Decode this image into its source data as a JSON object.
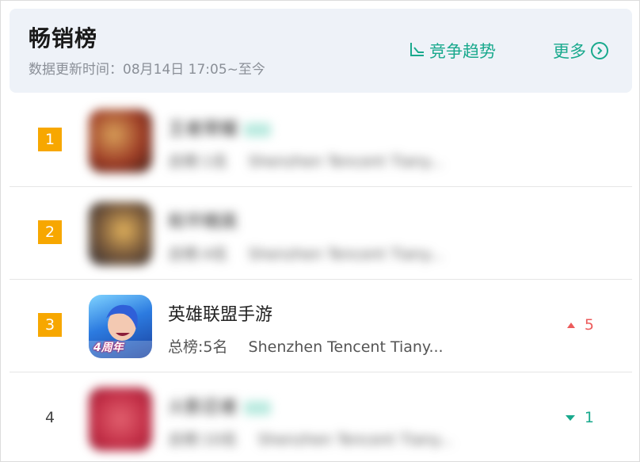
{
  "header": {
    "title": "畅销榜",
    "update_time": "数据更新时间：08月14日 17:05~至今",
    "trend_label": "竞争趋势",
    "more_label": "更多"
  },
  "colors": {
    "accent": "#19a98d",
    "rank_badge": "#f7a700",
    "rise": "#ec5b5b",
    "fall": "#19a98d",
    "header_bg": "#eef2f8"
  },
  "rows": [
    {
      "rank": "1",
      "name": "王者荣耀",
      "overall": "总榜:1名",
      "developer": "Shenzhen Tencent Tiany...",
      "blurred": true,
      "icon": "app-icon-blurred",
      "change": ""
    },
    {
      "rank": "2",
      "name": "和平精英",
      "overall": "总榜:4名",
      "developer": "Shenzhen Tencent Tiany...",
      "blurred": true,
      "icon": "app-icon-blurred",
      "change": ""
    },
    {
      "rank": "3",
      "name": "英雄联盟手游",
      "overall": "总榜:5名",
      "developer": "Shenzhen Tencent Tiany...",
      "blurred": false,
      "icon": "lol-mobile-app-icon",
      "icon_badge": "4周年",
      "change": "5",
      "direction": "up"
    },
    {
      "rank": "4",
      "name": "火影忍者",
      "overall": "总榜:10名",
      "developer": "Shenzhen Tencent Tiany...",
      "blurred": true,
      "icon": "app-icon-blurred",
      "change": "1",
      "direction": "down"
    }
  ]
}
